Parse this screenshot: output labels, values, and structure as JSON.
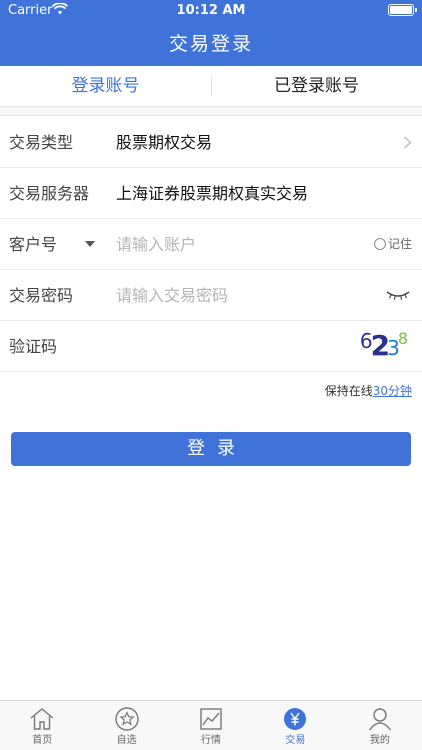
{
  "status_bar": {
    "carrier": "Carrier",
    "time": "10:12 AM"
  },
  "nav": {
    "title": "交易登录"
  },
  "tabs": [
    {
      "label": "登录账号",
      "active": true
    },
    {
      "label": "已登录账号",
      "active": false
    }
  ],
  "form": {
    "trade_type": {
      "label": "交易类型",
      "value": "股票期权交易"
    },
    "server": {
      "label": "交易服务器",
      "value": "上海证券股票期权真实交易"
    },
    "account": {
      "label": "客户号",
      "placeholder": "请输入账户",
      "remember_label": "记住"
    },
    "password": {
      "label": "交易密码",
      "placeholder": "请输入交易密码"
    },
    "captcha": {
      "label": "验证码",
      "digits": [
        "6",
        "2",
        "3",
        "8"
      ]
    }
  },
  "keep_online": {
    "prefix": "保持在线",
    "duration": "30分钟"
  },
  "login_button": {
    "label": "登录"
  },
  "tabbar": [
    {
      "label": "首页",
      "icon": "home-icon",
      "active": false
    },
    {
      "label": "自选",
      "icon": "star-icon",
      "active": false
    },
    {
      "label": "行情",
      "icon": "chart-icon",
      "active": false
    },
    {
      "label": "交易",
      "icon": "yen-icon",
      "active": true
    },
    {
      "label": "我的",
      "icon": "user-icon",
      "active": false
    }
  ],
  "colors": {
    "brand": "#3f73d9",
    "placeholder": "#b5b5b5"
  }
}
